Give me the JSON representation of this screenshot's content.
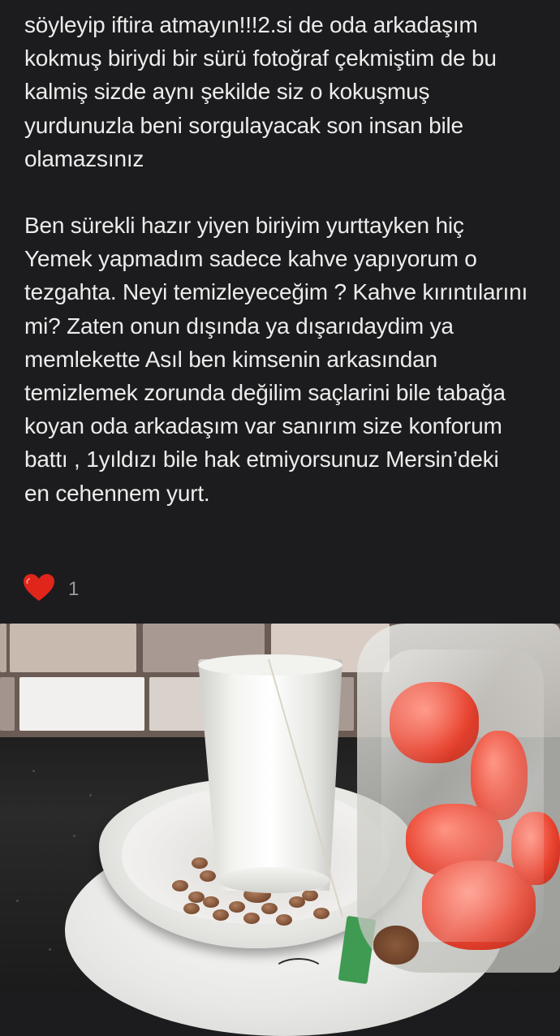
{
  "review": {
    "paragraphs": [
      [
        "söyleyip iftira atmayın!!!2.si de oda arkadaşım",
        "kokmuş biriydi bir sürü fotoğraf çekmiştim de bu",
        "kalmiş sizde aynı şekilde siz o kokuşmuş",
        "yurdunuzla beni sorgulayacak son insan bile",
        "olamazsınız"
      ],
      [
        "Ben sürekli hazır yiyen biriyim yurttayken hiç",
        "Yemek yapmadım sadece kahve yapıyorum o",
        "tezgahta. Neyi temizleyeceğim ? Kahve kırıntılarını",
        "mi? Zaten onun dışında ya dışarıdaydim ya",
        "memlekette Asıl ben kimsenin arkasından",
        "temizlemek zorunda değilim saçlarini bile tabağa",
        "koyan oda arkadaşım var sanırım size konforum",
        "battı , 1yıldızı bile hak etmiyorsunuz Mersin’deki",
        "en cehennem yurt."
      ]
    ]
  },
  "reactions": {
    "icon": "heart-icon",
    "count": "1",
    "heart_color": "#e0251b"
  },
  "photo": {
    "description_icon": "photo-attachment"
  }
}
